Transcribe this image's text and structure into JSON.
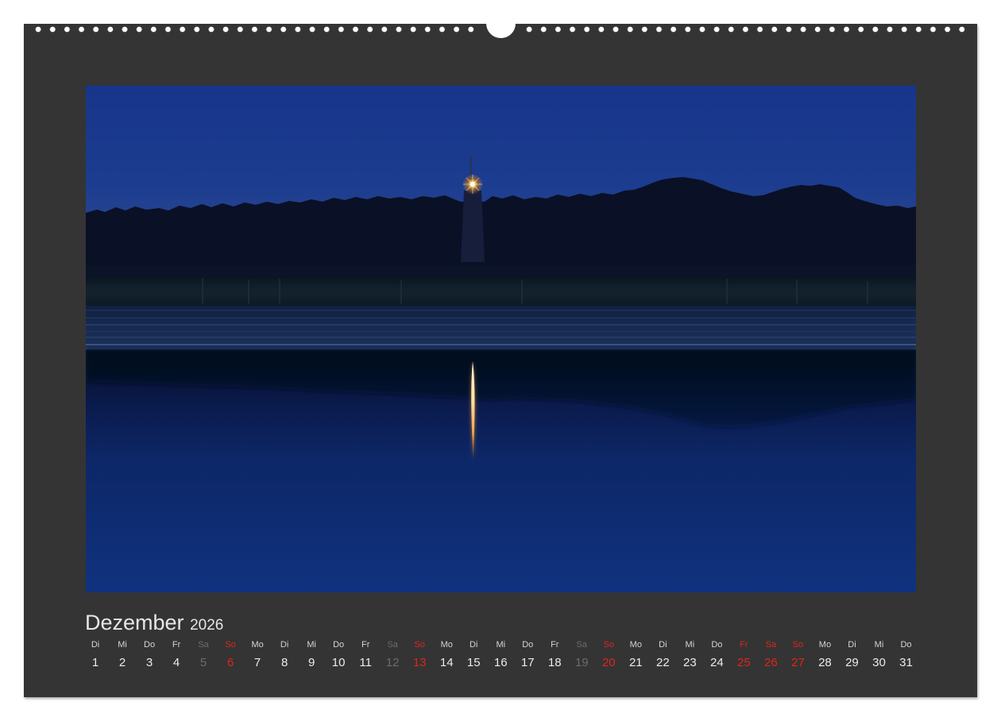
{
  "calendar": {
    "month": "Dezember",
    "year": "2026",
    "days": [
      {
        "weekday": "Di",
        "day": 1
      },
      {
        "weekday": "Mi",
        "day": 2
      },
      {
        "weekday": "Do",
        "day": 3
      },
      {
        "weekday": "Fr",
        "day": 4
      },
      {
        "weekday": "Sa",
        "day": 5,
        "color": "#6c6c6c"
      },
      {
        "weekday": "So",
        "day": 6,
        "color": "#e0241c"
      },
      {
        "weekday": "Mo",
        "day": 7
      },
      {
        "weekday": "Di",
        "day": 8
      },
      {
        "weekday": "Mi",
        "day": 9
      },
      {
        "weekday": "Do",
        "day": 10
      },
      {
        "weekday": "Fr",
        "day": 11
      },
      {
        "weekday": "Sa",
        "day": 12,
        "color": "#6c6c6c"
      },
      {
        "weekday": "So",
        "day": 13,
        "color": "#e0241c"
      },
      {
        "weekday": "Mo",
        "day": 14
      },
      {
        "weekday": "Di",
        "day": 15
      },
      {
        "weekday": "Mi",
        "day": 16
      },
      {
        "weekday": "Do",
        "day": 17
      },
      {
        "weekday": "Fr",
        "day": 18
      },
      {
        "weekday": "Sa",
        "day": 19,
        "color": "#6c6c6c"
      },
      {
        "weekday": "So",
        "day": 20,
        "color": "#e0241c"
      },
      {
        "weekday": "Mo",
        "day": 21
      },
      {
        "weekday": "Di",
        "day": 22
      },
      {
        "weekday": "Mi",
        "day": 23
      },
      {
        "weekday": "Do",
        "day": 24
      },
      {
        "weekday": "Fr",
        "day": 25,
        "color": "#e0241c"
      },
      {
        "weekday": "Sa",
        "day": 26,
        "color": "#e0241c"
      },
      {
        "weekday": "So",
        "day": 27,
        "color": "#e0241c"
      },
      {
        "weekday": "Mo",
        "day": 28
      },
      {
        "weekday": "Di",
        "day": 29
      },
      {
        "weekday": "Mi",
        "day": 30
      },
      {
        "weekday": "Do",
        "day": 31
      }
    ]
  }
}
